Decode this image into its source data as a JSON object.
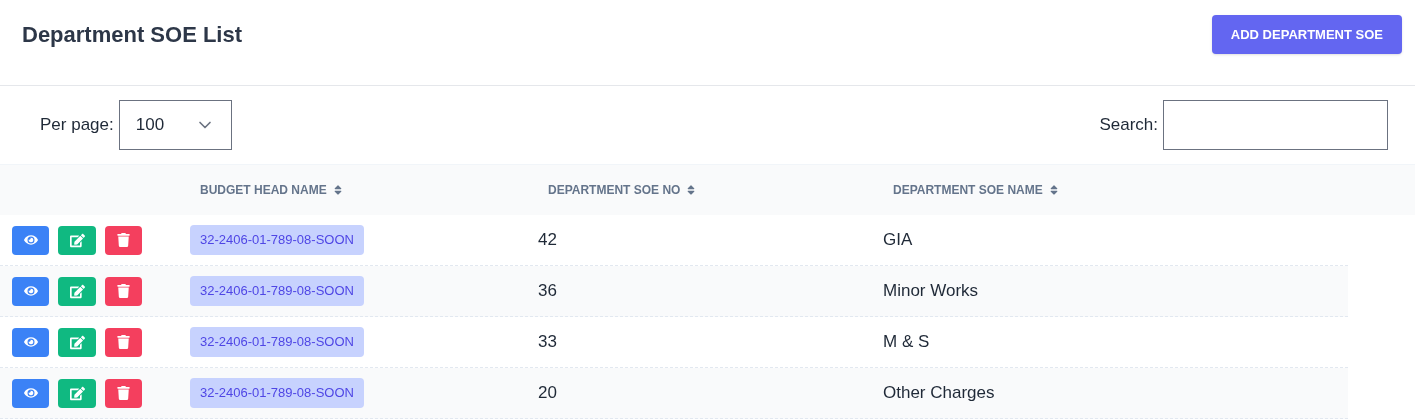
{
  "title": "Department SOE List",
  "add_button": "ADD DEPARTMENT SOE",
  "per_page": {
    "label": "Per page:",
    "value": "100"
  },
  "search": {
    "label": "Search:"
  },
  "columns": [
    "BUDGET HEAD NAME",
    "DEPARTMENT SOE NO",
    "DEPARTMENT SOE NAME"
  ],
  "rows": [
    {
      "budget_head": "32-2406-01-789-08-SOON",
      "soe_no": "42",
      "soe_name": "GIA"
    },
    {
      "budget_head": "32-2406-01-789-08-SOON",
      "soe_no": "36",
      "soe_name": "Minor Works"
    },
    {
      "budget_head": "32-2406-01-789-08-SOON",
      "soe_no": "33",
      "soe_name": "M & S"
    },
    {
      "budget_head": "32-2406-01-789-08-SOON",
      "soe_no": "20",
      "soe_name": "Other Charges"
    }
  ]
}
